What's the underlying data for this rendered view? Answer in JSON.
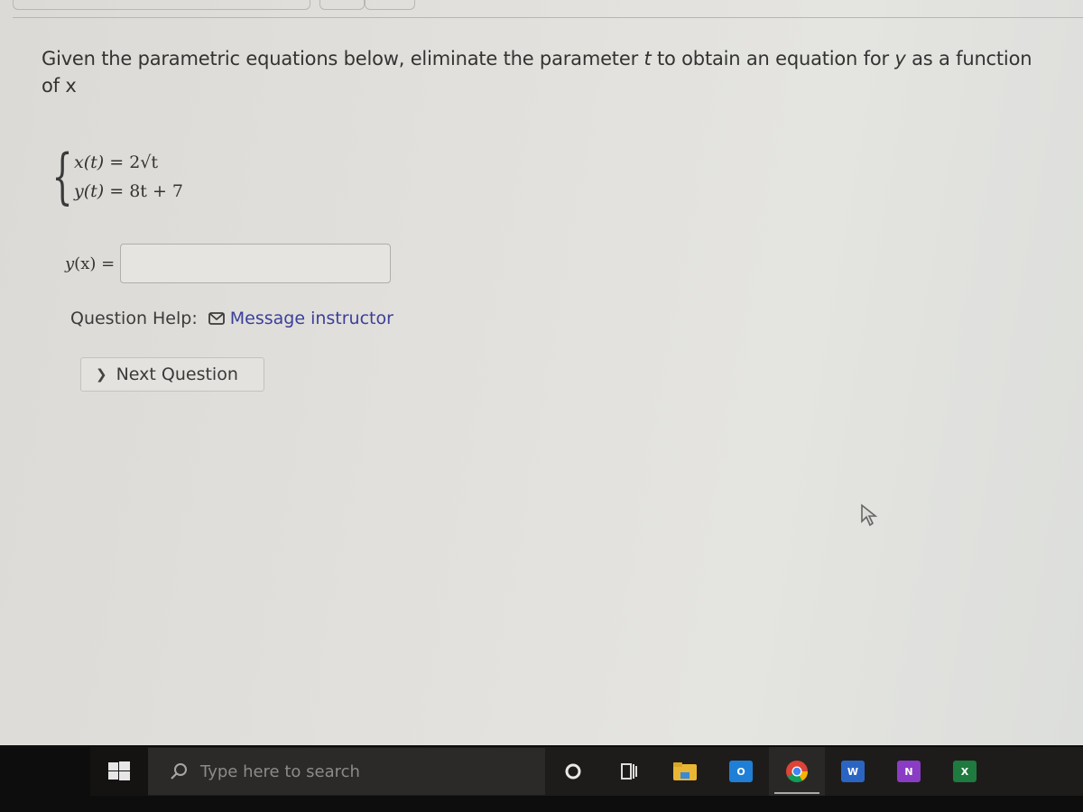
{
  "question": {
    "prompt_before": "Given the parametric equations below, eliminate the parameter ",
    "prompt_param": "t",
    "prompt_middle": " to obtain an equation for ",
    "prompt_var": "y",
    "prompt_after": " as a function of x",
    "equations": [
      {
        "lhs": "x(t)",
        "rhs": "= 2√t"
      },
      {
        "lhs": "y(t)",
        "rhs": "= 8t + 7"
      }
    ]
  },
  "answer": {
    "label_fn": "y",
    "label_arg": "(x)",
    "label_eq": " =",
    "value": "",
    "placeholder": ""
  },
  "help": {
    "label": "Question Help:",
    "link": "Message instructor",
    "link_color": "#3a3f9a"
  },
  "navigation": {
    "next_label": "Next Question",
    "next_icon": "chevron-right-icon"
  },
  "taskbar": {
    "search_placeholder": "Type here to search",
    "apps": [
      {
        "name": "cortana",
        "icon": "cortana-icon"
      },
      {
        "name": "task-view",
        "icon": "task-view-icon"
      },
      {
        "name": "file-explorer",
        "icon": "folder-icon",
        "color": "#e8b634"
      },
      {
        "name": "outlook",
        "icon": "outlook-icon",
        "label": "O",
        "color": "#1f7fd6"
      },
      {
        "name": "chrome",
        "icon": "chrome-icon",
        "active": true
      },
      {
        "name": "word",
        "icon": "word-icon",
        "label": "W",
        "color": "#2b65c4"
      },
      {
        "name": "onenote",
        "icon": "onenote-icon",
        "label": "N",
        "color": "#8a3cc4"
      },
      {
        "name": "excel",
        "icon": "excel-icon",
        "label": "X",
        "color": "#1e7a3e"
      }
    ]
  }
}
